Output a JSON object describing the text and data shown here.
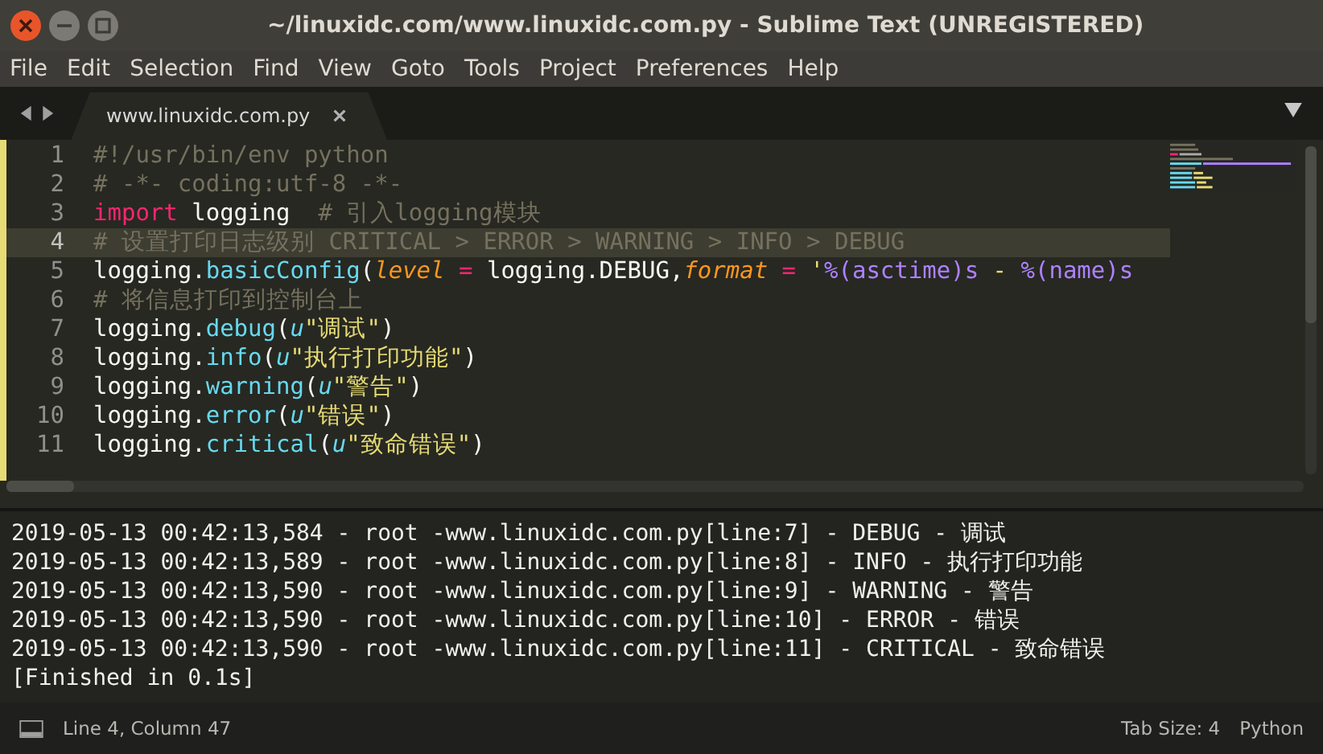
{
  "window": {
    "title": "~/linuxidc.com/www.linuxidc.com.py - Sublime Text (UNREGISTERED)"
  },
  "menu": [
    "File",
    "Edit",
    "Selection",
    "Find",
    "View",
    "Goto",
    "Tools",
    "Project",
    "Preferences",
    "Help"
  ],
  "tabs": [
    {
      "label": "www.linuxidc.com.py",
      "selected": true
    }
  ],
  "editor": {
    "lines": [
      {
        "number": "1",
        "current": false,
        "tokens": [
          {
            "kind": "comment",
            "text": "#!/usr/bin/env python"
          }
        ]
      },
      {
        "number": "2",
        "current": false,
        "tokens": [
          {
            "kind": "comment",
            "text": "# -*- coding:utf-8 -*-"
          }
        ]
      },
      {
        "number": "3",
        "current": false,
        "tokens": [
          {
            "kind": "keyword",
            "text": "import"
          },
          {
            "kind": "plain",
            "text": " logging  "
          },
          {
            "kind": "comment",
            "text": "# 引入logging模块"
          }
        ]
      },
      {
        "number": "4",
        "current": true,
        "tokens": [
          {
            "kind": "comment",
            "text": "# 设置打印日志级别 CRITICAL > ERROR > WARNING > INFO > DEBUG"
          }
        ]
      },
      {
        "number": "5",
        "current": false,
        "tokens": [
          {
            "kind": "plain",
            "text": "logging."
          },
          {
            "kind": "function",
            "text": "basicConfig"
          },
          {
            "kind": "plain",
            "text": "("
          },
          {
            "kind": "param",
            "text": "level"
          },
          {
            "kind": "operator",
            "text": " ="
          },
          {
            "kind": "plain",
            "text": " logging.DEBUG,"
          },
          {
            "kind": "param",
            "text": "format"
          },
          {
            "kind": "operator",
            "text": " ="
          },
          {
            "kind": "string",
            "text": " '"
          },
          {
            "kind": "placeholder",
            "text": "%(asctime)s"
          },
          {
            "kind": "string",
            "text": " - "
          },
          {
            "kind": "placeholder",
            "text": "%(name)s"
          }
        ]
      },
      {
        "number": "6",
        "current": false,
        "tokens": [
          {
            "kind": "comment",
            "text": "# 将信息打印到控制台上"
          }
        ]
      },
      {
        "number": "7",
        "current": false,
        "tokens": [
          {
            "kind": "plain",
            "text": "logging."
          },
          {
            "kind": "function",
            "text": "debug"
          },
          {
            "kind": "plain",
            "text": "("
          },
          {
            "kind": "prefix",
            "text": "u"
          },
          {
            "kind": "string",
            "text": "\"调试\""
          },
          {
            "kind": "plain",
            "text": ")"
          }
        ]
      },
      {
        "number": "8",
        "current": false,
        "tokens": [
          {
            "kind": "plain",
            "text": "logging."
          },
          {
            "kind": "function",
            "text": "info"
          },
          {
            "kind": "plain",
            "text": "("
          },
          {
            "kind": "prefix",
            "text": "u"
          },
          {
            "kind": "string",
            "text": "\"执行打印功能\""
          },
          {
            "kind": "plain",
            "text": ")"
          }
        ]
      },
      {
        "number": "9",
        "current": false,
        "tokens": [
          {
            "kind": "plain",
            "text": "logging."
          },
          {
            "kind": "function",
            "text": "warning"
          },
          {
            "kind": "plain",
            "text": "("
          },
          {
            "kind": "prefix",
            "text": "u"
          },
          {
            "kind": "string",
            "text": "\"警告\""
          },
          {
            "kind": "plain",
            "text": ")"
          }
        ]
      },
      {
        "number": "10",
        "current": false,
        "tokens": [
          {
            "kind": "plain",
            "text": "logging."
          },
          {
            "kind": "function",
            "text": "error"
          },
          {
            "kind": "plain",
            "text": "("
          },
          {
            "kind": "prefix",
            "text": "u"
          },
          {
            "kind": "string",
            "text": "\"错误\""
          },
          {
            "kind": "plain",
            "text": ")"
          }
        ]
      },
      {
        "number": "11",
        "current": false,
        "tokens": [
          {
            "kind": "plain",
            "text": "logging."
          },
          {
            "kind": "function",
            "text": "critical"
          },
          {
            "kind": "plain",
            "text": "("
          },
          {
            "kind": "prefix",
            "text": "u"
          },
          {
            "kind": "string",
            "text": "\"致命错误\""
          },
          {
            "kind": "plain",
            "text": ")"
          }
        ]
      }
    ]
  },
  "output": [
    "2019-05-13 00:42:13,584 - root -www.linuxidc.com.py[line:7] - DEBUG - 调试",
    "2019-05-13 00:42:13,589 - root -www.linuxidc.com.py[line:8] - INFO - 执行打印功能",
    "2019-05-13 00:42:13,590 - root -www.linuxidc.com.py[line:9] - WARNING - 警告",
    "2019-05-13 00:42:13,590 - root -www.linuxidc.com.py[line:10] - ERROR - 错误",
    "2019-05-13 00:42:13,590 - root -www.linuxidc.com.py[line:11] - CRITICAL - 致命错误",
    "[Finished in 0.1s]"
  ],
  "status_bar": {
    "position": "Line 4, Column 47",
    "tab_size": "Tab Size: 4",
    "syntax": "Python"
  }
}
